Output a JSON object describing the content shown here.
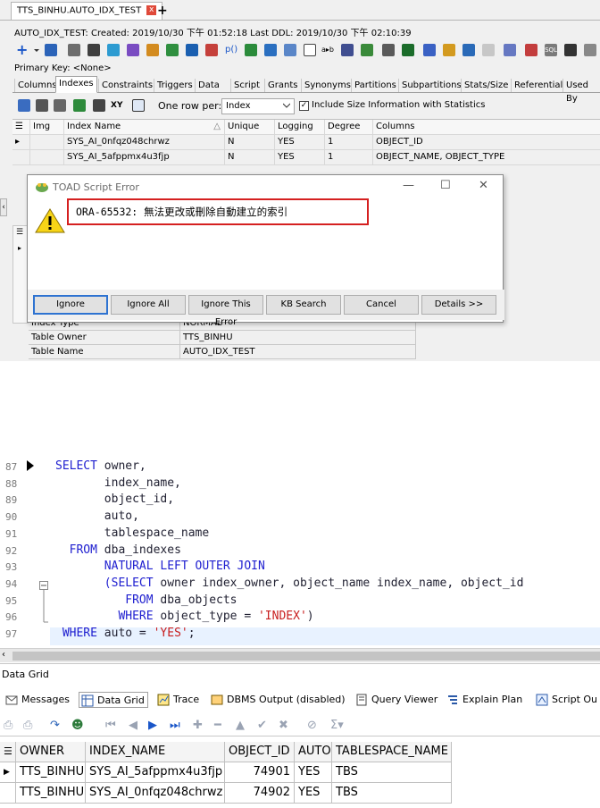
{
  "doc_tab": {
    "title": "TTS_BINHU.AUTO_IDX_TEST",
    "close": "x",
    "add": "+"
  },
  "info_line": "AUTO_IDX_TEST:   Created: 2019/10/30 下午 01:52:18   Last DDL: 2019/10/30 下午 02:10:39",
  "primary_key": "Primary Key:  <None>",
  "object_tabs": [
    "Columns",
    "Indexes",
    "Constraints",
    "Triggers",
    "Data",
    "Script",
    "Grants",
    "Synonyms",
    "Partitions",
    "Subpartitions",
    "Stats/Size",
    "Referential",
    "Used By"
  ],
  "active_object_tab": "Indexes",
  "sub_toolbar": {
    "xy_label": "XY",
    "one_row_per_label": "One row per:",
    "one_row_per_value": "Index",
    "include_size_label": "Include Size Information with Statistics",
    "include_size_checked": true
  },
  "index_grid": {
    "headers": [
      "Img",
      "Index Name",
      "Unique",
      "Logging",
      "Degree",
      "Columns"
    ],
    "rows": [
      [
        "",
        "SYS_AI_0nfqz048chrwz",
        "N",
        "YES",
        "1",
        "OBJECT_ID"
      ],
      [
        "",
        "SYS_AI_5afppmx4u3fjp",
        "N",
        "YES",
        "1",
        "OBJECT_NAME, OBJECT_TYPE"
      ]
    ]
  },
  "properties": {
    "rows": [
      [
        "Index Type",
        "NORMAL"
      ],
      [
        "Table Owner",
        "TTS_BINHU"
      ],
      [
        "Table Name",
        "AUTO_IDX_TEST"
      ]
    ]
  },
  "dialog": {
    "title": "TOAD Script Error",
    "message": "ORA-65532: 無法更改或刪除自動建立的索引",
    "buttons": [
      "Ignore",
      "Ignore All",
      "Ignore This Error",
      "KB Search",
      "Cancel",
      "Details >>"
    ],
    "controls": [
      "—",
      "☐",
      "✕"
    ]
  },
  "editor": {
    "line_numbers": [
      "87",
      "88",
      "89",
      "90",
      "91",
      "92",
      "93",
      "94",
      "95",
      "96",
      "97"
    ],
    "lines": [
      [
        [
          "kw",
          "SELECT "
        ],
        [
          "id",
          "owner,"
        ]
      ],
      [
        [
          "id",
          "       index_name,"
        ]
      ],
      [
        [
          "id",
          "       object_id,"
        ]
      ],
      [
        [
          "id",
          "       auto,"
        ]
      ],
      [
        [
          "id",
          "       tablespace_name"
        ]
      ],
      [
        [
          "kw",
          "  FROM "
        ],
        [
          "id",
          "dba_indexes"
        ]
      ],
      [
        [
          "kw",
          "       NATURAL LEFT OUTER JOIN"
        ]
      ],
      [
        [
          "kw",
          "       (SELECT "
        ],
        [
          "id",
          "owner "
        ],
        [
          "id",
          "index_owner, "
        ],
        [
          "id",
          "object_name "
        ],
        [
          "id",
          "index_name, "
        ],
        [
          "id",
          "object_id"
        ]
      ],
      [
        [
          "kw",
          "          FROM "
        ],
        [
          "id",
          "dba_objects"
        ]
      ],
      [
        [
          "kw",
          "         WHERE "
        ],
        [
          "id",
          "object_type = "
        ],
        [
          "str",
          "'INDEX'"
        ],
        [
          "id",
          ")"
        ]
      ],
      [
        [
          "kw",
          " WHERE "
        ],
        [
          "id",
          "auto = "
        ],
        [
          "str",
          "'YES'"
        ],
        [
          "id",
          ";"
        ]
      ]
    ]
  },
  "data_grid_label": "Data Grid",
  "result_tabs": [
    "Messages",
    "Data Grid",
    "Trace",
    "DBMS Output (disabled)",
    "Query Viewer",
    "Explain Plan",
    "Script Ou"
  ],
  "active_result_tab": "Data Grid",
  "results": {
    "headers": [
      "OWNER",
      "INDEX_NAME",
      "OBJECT_ID",
      "AUTO",
      "TABLESPACE_NAME"
    ],
    "rows": [
      [
        "TTS_BINHU",
        "SYS_AI_5afppmx4u3fjp",
        "74901",
        "YES",
        "TBS"
      ],
      [
        "TTS_BINHU",
        "SYS_AI_0nfqz048chrwz",
        "74902",
        "YES",
        "TBS"
      ]
    ]
  },
  "colors": {
    "keyword": "#2020d0",
    "string": "#c81e1e",
    "error_border": "#d52020",
    "accent": "#2e73d1"
  }
}
